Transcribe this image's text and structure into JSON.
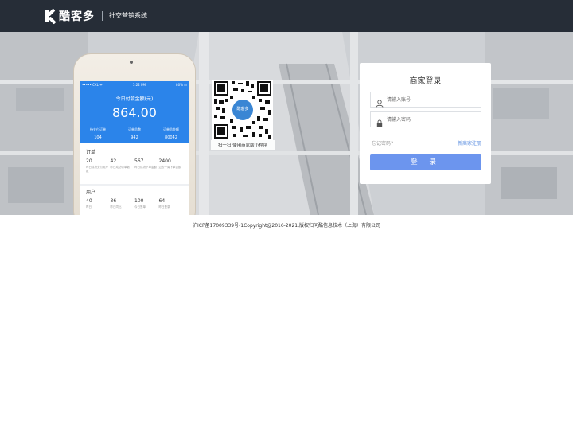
{
  "header": {
    "logo_text": "酷客多",
    "system_name": "社交营销系统"
  },
  "phone": {
    "status": {
      "carrier": "••••• CXL ᯤ",
      "time": "5:22 PM",
      "battery": "80% ▭"
    },
    "pay_label": "今日付款金额(元)",
    "pay_amount": "864.00",
    "stats": [
      {
        "label": "待支付订单",
        "value": "104"
      },
      {
        "label": "订单总数",
        "value": "942"
      },
      {
        "label": "订单总金额",
        "value": "80042"
      }
    ],
    "orders": {
      "title": "订单",
      "cells": [
        {
          "value": "20",
          "label": "昨日成功支付用户数"
        },
        {
          "value": "42",
          "label": "昨日成功订单数"
        },
        {
          "value": "567",
          "label": "昨日成功下单金额"
        },
        {
          "value": "2400",
          "label": "过去一周下单金额"
        }
      ]
    },
    "users": {
      "title": "用户",
      "cells": [
        {
          "value": "40",
          "label": "昨日"
        },
        {
          "value": "36",
          "label": "昨日同比"
        },
        {
          "value": "100",
          "label": "今日签单"
        },
        {
          "value": "64",
          "label": "昨日登录"
        }
      ]
    }
  },
  "qr": {
    "caption": "扫一扫 使用商家版小程序",
    "center_text": "酷客多"
  },
  "login": {
    "title": "商家登录",
    "account_placeholder": "请输入账号",
    "password_placeholder": "请输入密码",
    "forgot": "忘记密码?",
    "register": "新商家注册",
    "submit": "登 录",
    "icons": {
      "account": "user-icon",
      "password": "lock-icon"
    }
  },
  "footer": {
    "text": "沪ICP备17009339号-1Copyright@2016-2021,版权归问酷信息技术（上海）有限公司"
  },
  "colors": {
    "header_bg": "#262d37",
    "phone_blue": "#2b84ea",
    "button_blue": "#6c95ee",
    "link_blue": "#5d8fe0"
  }
}
